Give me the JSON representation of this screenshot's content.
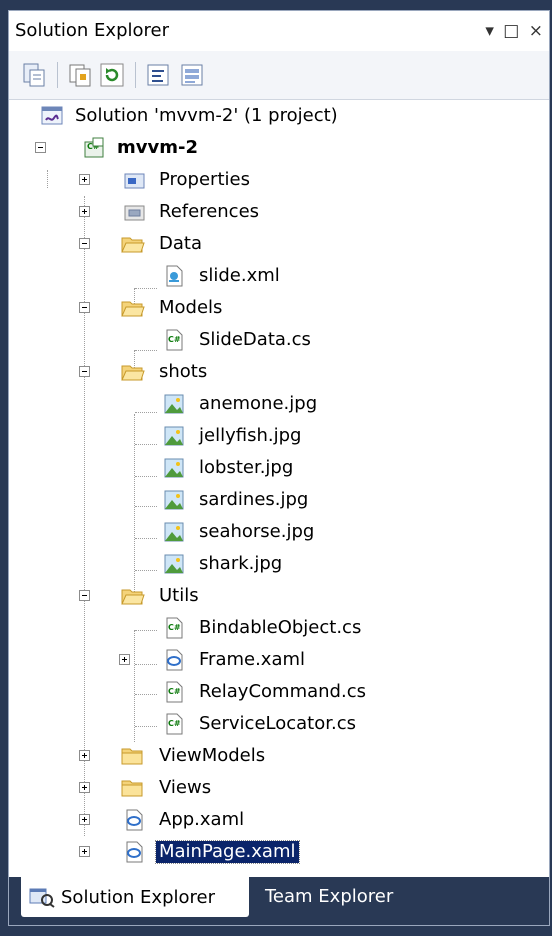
{
  "window": {
    "title": "Solution Explorer",
    "buttons": "▾ □ ×"
  },
  "toolbar": {
    "icons": [
      "properties-icon",
      "show-all-files-icon",
      "refresh-icon",
      "view-code-icon",
      "view-designer-icon"
    ]
  },
  "tree": {
    "solution_label": "Solution 'mvvm-2' (1 project)",
    "project_label": "mvvm-2",
    "items": [
      {
        "label": "Properties"
      },
      {
        "label": "References"
      },
      {
        "label": "Data"
      },
      {
        "label": "slide.xml"
      },
      {
        "label": "Models"
      },
      {
        "label": "SlideData.cs"
      },
      {
        "label": "shots"
      },
      {
        "label": "anemone.jpg"
      },
      {
        "label": "jellyfish.jpg"
      },
      {
        "label": "lobster.jpg"
      },
      {
        "label": "sardines.jpg"
      },
      {
        "label": "seahorse.jpg"
      },
      {
        "label": "shark.jpg"
      },
      {
        "label": "Utils"
      },
      {
        "label": "BindableObject.cs"
      },
      {
        "label": "Frame.xaml"
      },
      {
        "label": "RelayCommand.cs"
      },
      {
        "label": "ServiceLocator.cs"
      },
      {
        "label": "ViewModels"
      },
      {
        "label": "Views"
      },
      {
        "label": "App.xaml"
      },
      {
        "label": "MainPage.xaml"
      }
    ]
  },
  "tabs": {
    "solution_explorer": "Solution Explorer",
    "team_explorer": "Team Explorer"
  },
  "colors": {
    "selection": "#0a246a",
    "background": "#293955"
  }
}
